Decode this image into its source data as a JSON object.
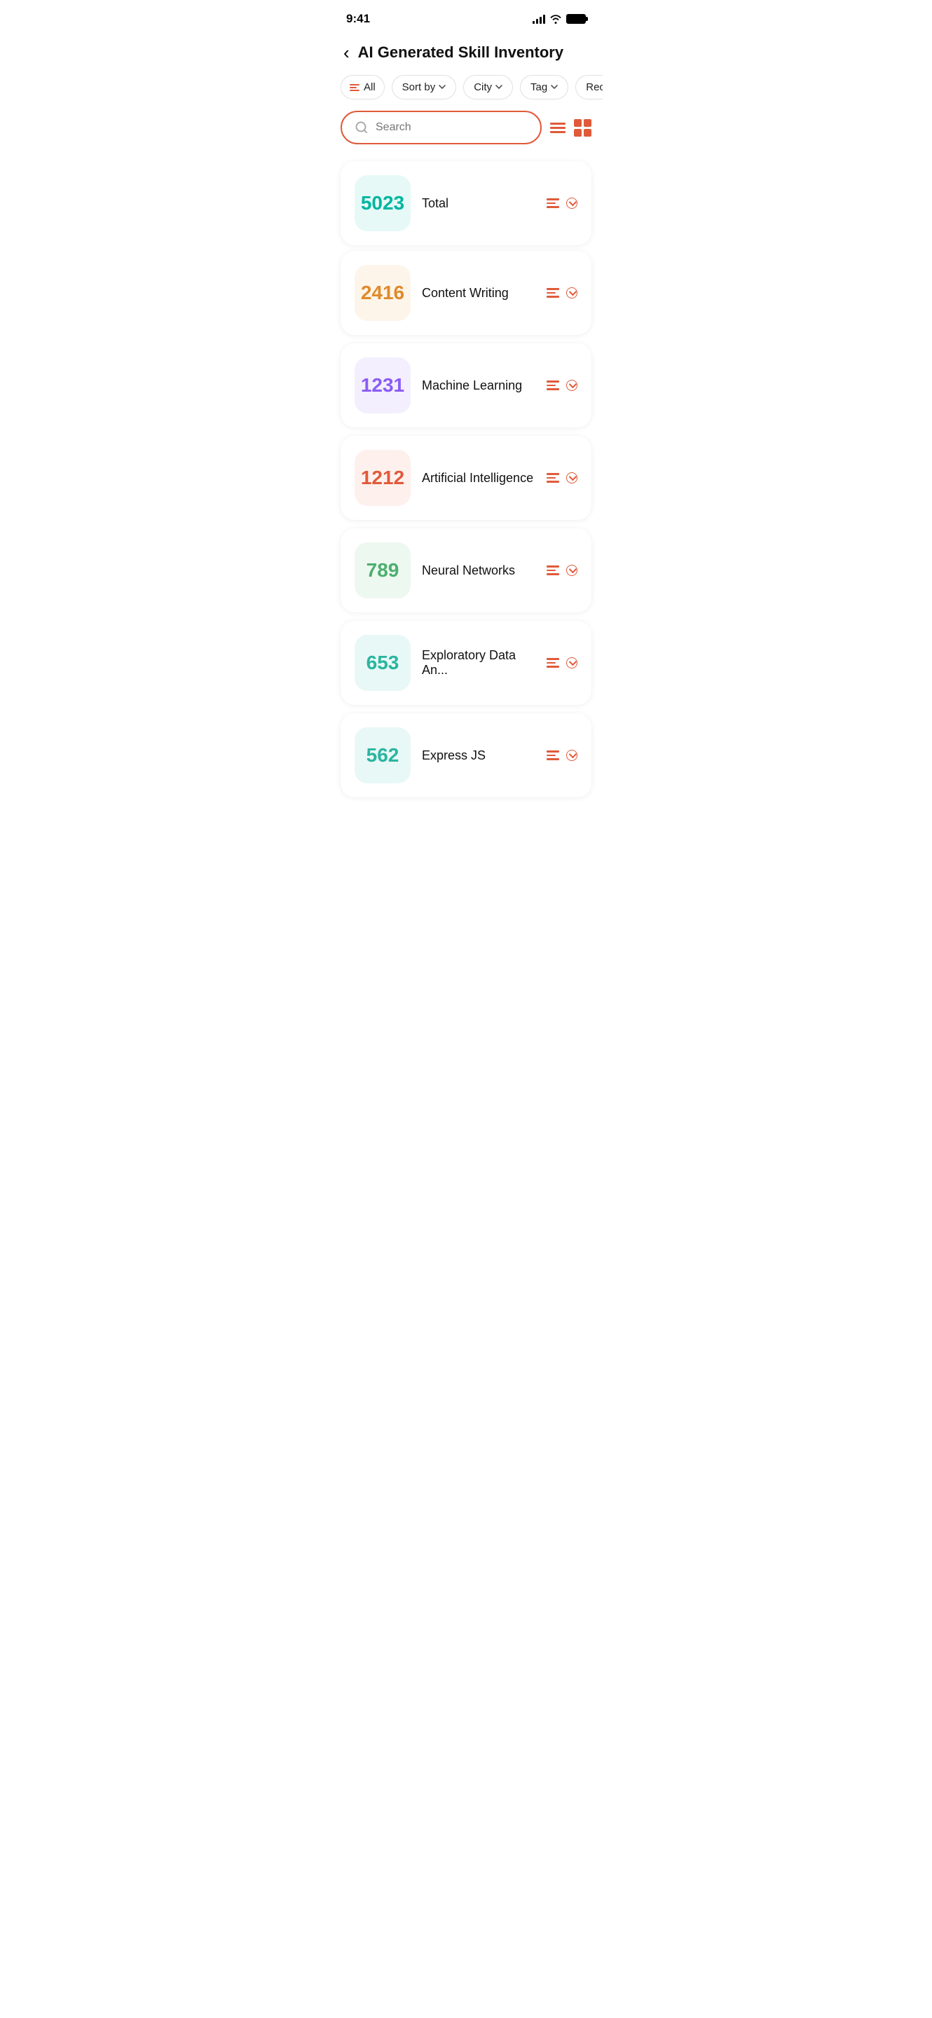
{
  "statusBar": {
    "time": "9:41"
  },
  "header": {
    "title": "AI Generated Skill Inventory",
    "backLabel": "‹"
  },
  "filters": {
    "all": "All",
    "sortBy": "Sort by",
    "city": "City",
    "tag": "Tag",
    "recent": "Rece..."
  },
  "search": {
    "placeholder": "Search"
  },
  "summary": {
    "count": "5023",
    "label": "Total",
    "countColor": "#00b5a0"
  },
  "skills": [
    {
      "count": "2416",
      "name": "Content Writing",
      "countColor": "#e08a2a",
      "bgColor": "#fdf5ea"
    },
    {
      "count": "1231",
      "name": "Machine Learning",
      "countColor": "#8b5cf6",
      "bgColor": "#f3effe"
    },
    {
      "count": "1212",
      "name": "Artificial Intelligence",
      "countColor": "#e05a3a",
      "bgColor": "#fef0ed"
    },
    {
      "count": "789",
      "name": "Neural Networks",
      "countColor": "#4caf6e",
      "bgColor": "#edf8f1"
    },
    {
      "count": "653",
      "name": "Exploratory Data An...",
      "countColor": "#2ab5a0",
      "bgColor": "#e8f8f6"
    },
    {
      "count": "562",
      "name": "Express JS",
      "countColor": "#2ab5a0",
      "bgColor": "#e8f8f6"
    }
  ],
  "colors": {
    "accent": "#e05a3a",
    "totalCountColor": "#00b5a0",
    "totalBg": "#e6f9f7"
  }
}
